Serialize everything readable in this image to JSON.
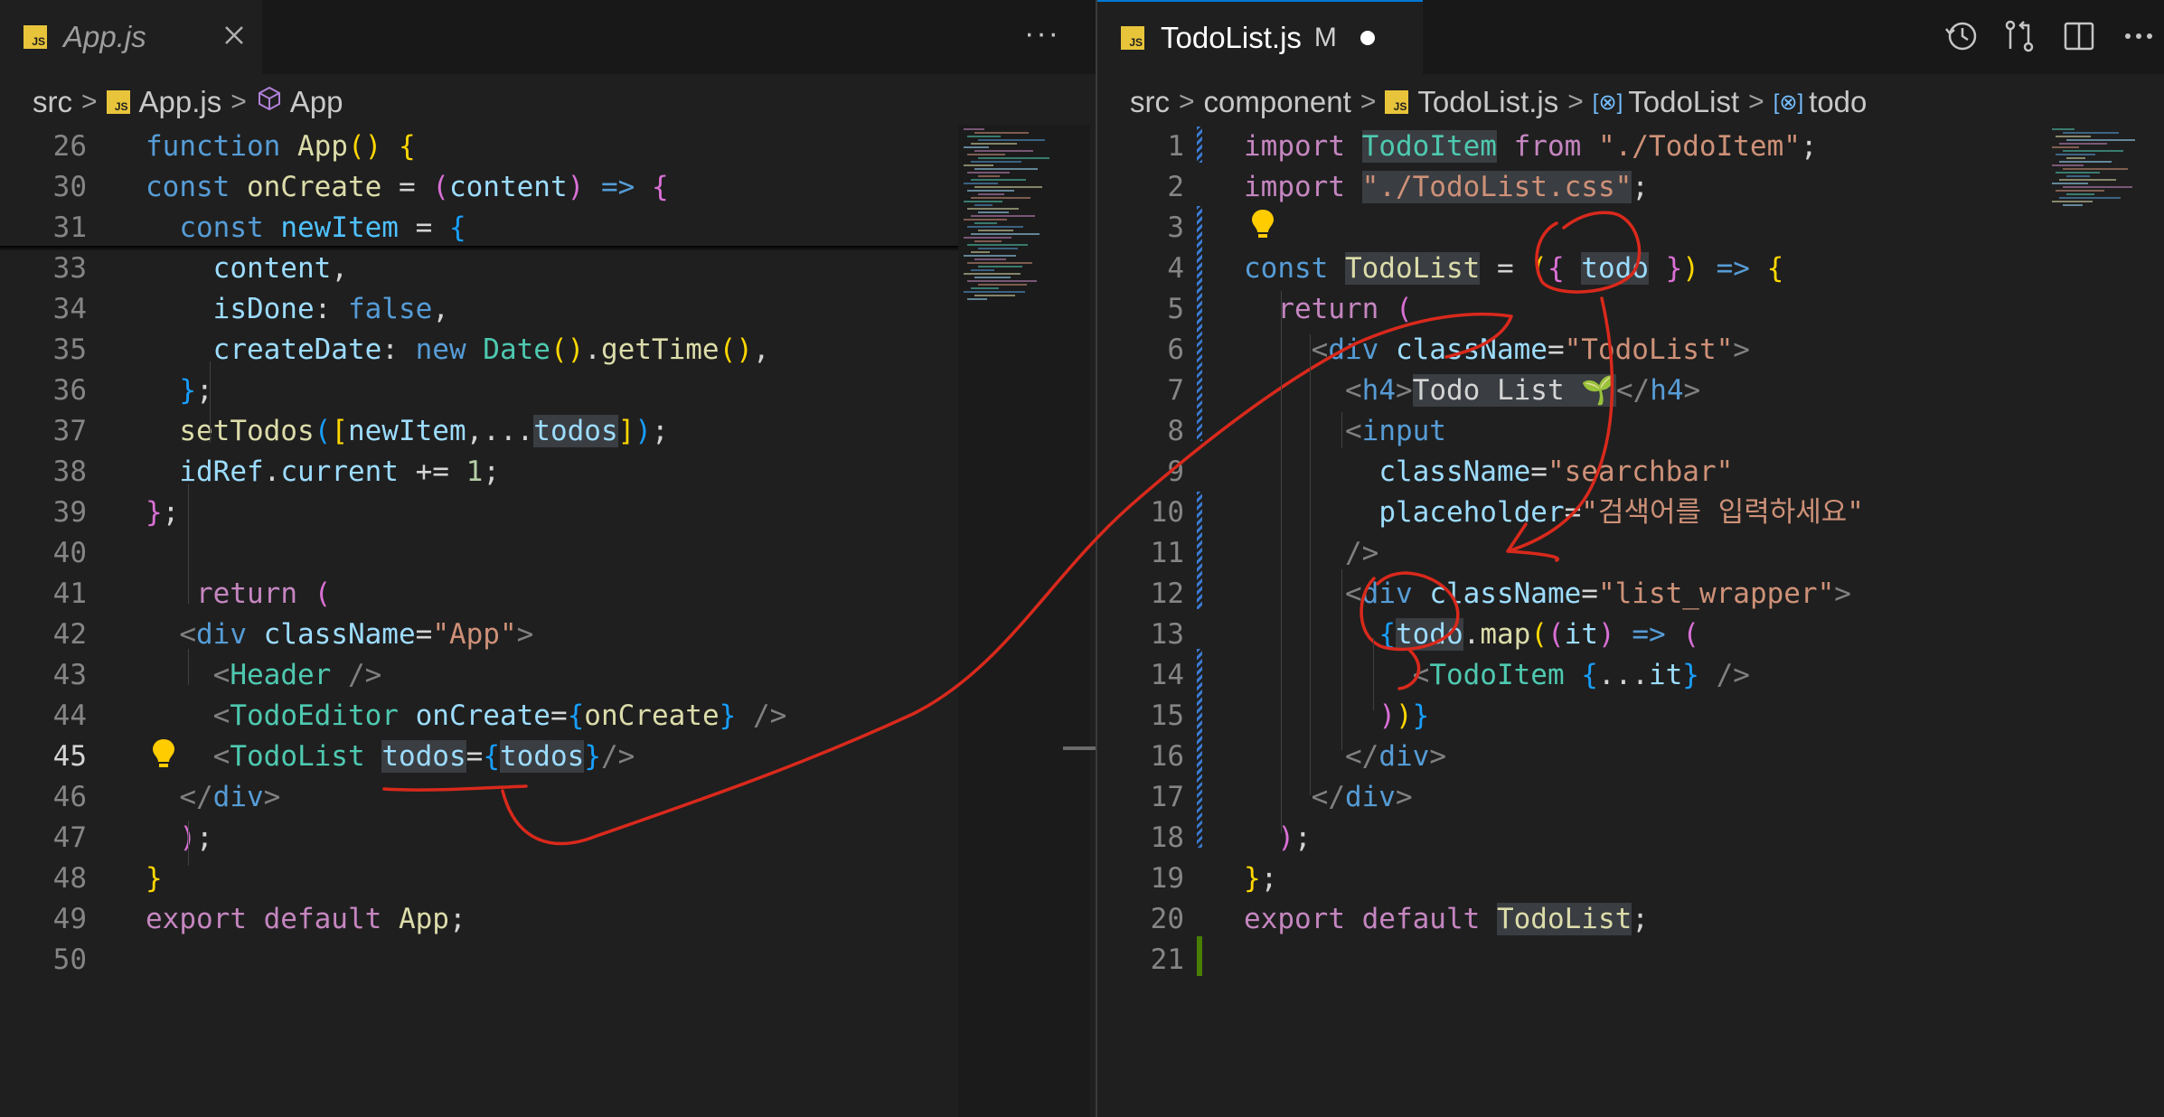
{
  "left": {
    "tab": {
      "file": "App.js",
      "icon": "JS"
    },
    "more_label": "···",
    "breadcrumb": [
      "src",
      "App.js",
      "App"
    ],
    "lines": [
      {
        "n": "26",
        "tokens": [
          [
            "st",
            "function "
          ],
          [
            "fn",
            "App"
          ],
          [
            "br1",
            "() {"
          ]
        ]
      },
      {
        "n": "30",
        "tokens": [
          [
            "st",
            "const "
          ],
          [
            "fn",
            "onCreate"
          ],
          [
            "pl",
            " = "
          ],
          [
            "br2",
            "("
          ],
          [
            "var",
            "content"
          ],
          [
            "br2",
            ")"
          ],
          [
            "st",
            " => "
          ],
          [
            "br2",
            "{"
          ]
        ]
      },
      {
        "n": "31",
        "tokens": [
          [
            "pl",
            "  "
          ],
          [
            "st",
            "const "
          ],
          [
            "cst",
            "newItem"
          ],
          [
            "pl",
            " = "
          ],
          [
            "br3",
            "{"
          ]
        ]
      },
      {
        "n": "33",
        "tokens": [
          [
            "pl",
            "    "
          ],
          [
            "var",
            "content"
          ],
          [
            "pl",
            ","
          ]
        ]
      },
      {
        "n": "34",
        "tokens": [
          [
            "pl",
            "    "
          ],
          [
            "var",
            "isDone"
          ],
          [
            "pl",
            ": "
          ],
          [
            "st",
            "false"
          ],
          [
            "pl",
            ","
          ]
        ]
      },
      {
        "n": "35",
        "tokens": [
          [
            "pl",
            "    "
          ],
          [
            "var",
            "createDate"
          ],
          [
            "pl",
            ": "
          ],
          [
            "st",
            "new "
          ],
          [
            "cmp",
            "Date"
          ],
          [
            "br1",
            "()"
          ],
          [
            "pl",
            "."
          ],
          [
            "fn",
            "getTime"
          ],
          [
            "br1",
            "()"
          ],
          [
            "pl",
            ","
          ]
        ]
      },
      {
        "n": "36",
        "tokens": [
          [
            "pl",
            "  "
          ],
          [
            "br3",
            "}"
          ],
          [
            "pl",
            ";"
          ]
        ]
      },
      {
        "n": "37",
        "tokens": [
          [
            "pl",
            "  "
          ],
          [
            "fn",
            "setTodos"
          ],
          [
            "br3",
            "("
          ],
          [
            "br1",
            "["
          ],
          [
            "var",
            "newItem"
          ],
          [
            "pl",
            ",..."
          ],
          [
            "var",
            "todos"
          ],
          [
            "br1",
            "]"
          ],
          [
            "br3",
            ")"
          ],
          [
            "pl",
            ";"
          ]
        ]
      },
      {
        "n": "38",
        "tokens": [
          [
            "pl",
            "  "
          ],
          [
            "var",
            "idRef"
          ],
          [
            "pl",
            "."
          ],
          [
            "var",
            "current"
          ],
          [
            "pl",
            " += "
          ],
          [
            "num",
            "1"
          ],
          [
            "pl",
            ";"
          ]
        ]
      },
      {
        "n": "39",
        "tokens": [
          [
            "br2",
            "}"
          ],
          [
            "pl",
            ";"
          ]
        ]
      },
      {
        "n": "40",
        "tokens": []
      },
      {
        "n": "41",
        "tokens": [
          [
            "pl",
            "   "
          ],
          [
            "kw",
            "return "
          ],
          [
            "br2",
            "("
          ]
        ]
      },
      {
        "n": "42",
        "tokens": [
          [
            "pl",
            "  "
          ],
          [
            "pun",
            "<"
          ],
          [
            "tag",
            "div "
          ],
          [
            "attr",
            "className"
          ],
          [
            "pl",
            "="
          ],
          [
            "str",
            "\"App\""
          ],
          [
            "pun",
            ">"
          ]
        ]
      },
      {
        "n": "43",
        "tokens": [
          [
            "pl",
            "    "
          ],
          [
            "pun",
            "<"
          ],
          [
            "cmp",
            "Header"
          ],
          [
            "pun",
            " />"
          ]
        ]
      },
      {
        "n": "44",
        "tokens": [
          [
            "pl",
            "    "
          ],
          [
            "pun",
            "<"
          ],
          [
            "cmp",
            "TodoEditor "
          ],
          [
            "attr",
            "onCreate"
          ],
          [
            "pl",
            "="
          ],
          [
            "br3",
            "{"
          ],
          [
            "fn",
            "onCreate"
          ],
          [
            "br3",
            "}"
          ],
          [
            "pun",
            " />"
          ]
        ]
      },
      {
        "n": "45",
        "tokens": [
          [
            "pl",
            "    "
          ],
          [
            "pun",
            "<"
          ],
          [
            "cmp",
            "TodoList "
          ],
          [
            "attr",
            "todos"
          ],
          [
            "pl",
            "="
          ],
          [
            "br3",
            "{"
          ],
          [
            "var",
            "todos"
          ],
          [
            "br3",
            "}"
          ],
          [
            "pun",
            "/>"
          ]
        ]
      },
      {
        "n": "46",
        "tokens": [
          [
            "pl",
            "  "
          ],
          [
            "pun",
            "</"
          ],
          [
            "tag",
            "div"
          ],
          [
            "pun",
            ">"
          ]
        ]
      },
      {
        "n": "47",
        "tokens": [
          [
            "pl",
            "  "
          ],
          [
            "br2",
            ")"
          ],
          [
            "pl",
            ";"
          ]
        ]
      },
      {
        "n": "48",
        "tokens": [
          [
            "br1",
            "}"
          ]
        ]
      },
      {
        "n": "49",
        "tokens": [
          [
            "kw",
            "export default "
          ],
          [
            "fn",
            "App"
          ],
          [
            "pl",
            ";"
          ]
        ]
      },
      {
        "n": "50",
        "tokens": []
      }
    ]
  },
  "right": {
    "tab": {
      "file": "TodoList.js",
      "icon": "JS",
      "status": "M"
    },
    "breadcrumb": [
      "src",
      "component",
      "TodoList.js",
      "TodoList",
      "todo"
    ],
    "lines": [
      {
        "n": "1",
        "tokens": [
          [
            "kw",
            "import "
          ],
          [
            "cmp",
            "TodoItem"
          ],
          [
            "kw",
            " from "
          ],
          [
            "str",
            "\"./TodoItem\""
          ],
          [
            "pl",
            ";"
          ]
        ]
      },
      {
        "n": "2",
        "tokens": [
          [
            "kw",
            "import "
          ],
          [
            "str",
            "\"./TodoList.css\""
          ],
          [
            "pl",
            ";"
          ]
        ]
      },
      {
        "n": "3",
        "tokens": []
      },
      {
        "n": "4",
        "tokens": [
          [
            "st",
            "const "
          ],
          [
            "fn",
            "TodoList"
          ],
          [
            "pl",
            " = "
          ],
          [
            "br1",
            "("
          ],
          [
            "br2",
            "{ "
          ],
          [
            "var",
            "todo"
          ],
          [
            "br2",
            " }"
          ],
          [
            "br1",
            ")"
          ],
          [
            "st",
            " => "
          ],
          [
            "br1",
            "{"
          ]
        ]
      },
      {
        "n": "5",
        "tokens": [
          [
            "pl",
            "  "
          ],
          [
            "kw",
            "return "
          ],
          [
            "br2",
            "("
          ]
        ]
      },
      {
        "n": "6",
        "tokens": [
          [
            "pl",
            "    "
          ],
          [
            "pun",
            "<"
          ],
          [
            "tag",
            "div "
          ],
          [
            "attr",
            "className"
          ],
          [
            "pl",
            "="
          ],
          [
            "str",
            "\"TodoList\""
          ],
          [
            "pun",
            ">"
          ]
        ]
      },
      {
        "n": "7",
        "tokens": [
          [
            "pl",
            "      "
          ],
          [
            "pun",
            "<"
          ],
          [
            "tag",
            "h4"
          ],
          [
            "pun",
            ">"
          ],
          [
            "pl",
            "Todo List 🌱"
          ],
          [
            "pun",
            "</"
          ],
          [
            "tag",
            "h4"
          ],
          [
            "pun",
            ">"
          ]
        ]
      },
      {
        "n": "8",
        "tokens": [
          [
            "pl",
            "      "
          ],
          [
            "pun",
            "<"
          ],
          [
            "tag",
            "input"
          ]
        ]
      },
      {
        "n": "9",
        "tokens": [
          [
            "pl",
            "        "
          ],
          [
            "attr",
            "className"
          ],
          [
            "pl",
            "="
          ],
          [
            "str",
            "\"searchbar\""
          ]
        ]
      },
      {
        "n": "10",
        "tokens": [
          [
            "pl",
            "        "
          ],
          [
            "attr",
            "placeholder"
          ],
          [
            "pl",
            "="
          ],
          [
            "str",
            "\"검색어를 입력하세요\""
          ]
        ]
      },
      {
        "n": "11",
        "tokens": [
          [
            "pl",
            "      "
          ],
          [
            "pun",
            "/>"
          ]
        ]
      },
      {
        "n": "12",
        "tokens": [
          [
            "pl",
            "      "
          ],
          [
            "pun",
            "<"
          ],
          [
            "tag",
            "div "
          ],
          [
            "attr",
            "className"
          ],
          [
            "pl",
            "="
          ],
          [
            "str",
            "\"list_wrapper\""
          ],
          [
            "pun",
            ">"
          ]
        ]
      },
      {
        "n": "13",
        "tokens": [
          [
            "pl",
            "        "
          ],
          [
            "br3",
            "{"
          ],
          [
            "var",
            "todo"
          ],
          [
            "pl",
            "."
          ],
          [
            "fn",
            "map"
          ],
          [
            "br1",
            "("
          ],
          [
            "br2",
            "("
          ],
          [
            "var",
            "it"
          ],
          [
            "br2",
            ")"
          ],
          [
            "st",
            " => "
          ],
          [
            "br2",
            "("
          ]
        ]
      },
      {
        "n": "14",
        "tokens": [
          [
            "pl",
            "          "
          ],
          [
            "pun",
            "<"
          ],
          [
            "cmp",
            "TodoItem "
          ],
          [
            "br3",
            "{"
          ],
          [
            "pl",
            "..."
          ],
          [
            "var",
            "it"
          ],
          [
            "br3",
            "}"
          ],
          [
            "pun",
            " />"
          ]
        ]
      },
      {
        "n": "15",
        "tokens": [
          [
            "pl",
            "        "
          ],
          [
            "br2",
            ")"
          ],
          [
            "br1",
            ")"
          ],
          [
            "br3",
            "}"
          ]
        ]
      },
      {
        "n": "16",
        "tokens": [
          [
            "pl",
            "      "
          ],
          [
            "pun",
            "</"
          ],
          [
            "tag",
            "div"
          ],
          [
            "pun",
            ">"
          ]
        ]
      },
      {
        "n": "17",
        "tokens": [
          [
            "pl",
            "    "
          ],
          [
            "pun",
            "</"
          ],
          [
            "tag",
            "div"
          ],
          [
            "pun",
            ">"
          ]
        ]
      },
      {
        "n": "18",
        "tokens": [
          [
            "pl",
            "  "
          ],
          [
            "br2",
            ")"
          ],
          [
            "pl",
            ";"
          ]
        ]
      },
      {
        "n": "19",
        "tokens": [
          [
            "br1",
            "}"
          ],
          [
            "pl",
            ";"
          ]
        ]
      },
      {
        "n": "20",
        "tokens": [
          [
            "kw",
            "export default "
          ],
          [
            "fn",
            "TodoList"
          ],
          [
            "pl",
            ";"
          ]
        ]
      },
      {
        "n": "21",
        "tokens": []
      }
    ]
  },
  "colors": {
    "annotation": "#d9291c",
    "keyword_blue": "#569cd6",
    "keyword_purple": "#c586c0",
    "function_yellow": "#dcdcaa",
    "string_orange": "#ce9178",
    "component_teal": "#4ec9b0",
    "variable_blue": "#9cdcfe",
    "tab_js_yellow": "#e8c43a"
  },
  "toolbar_icons": [
    "timeline-icon",
    "compare-changes-icon",
    "split-editor-icon",
    "more-icon"
  ]
}
